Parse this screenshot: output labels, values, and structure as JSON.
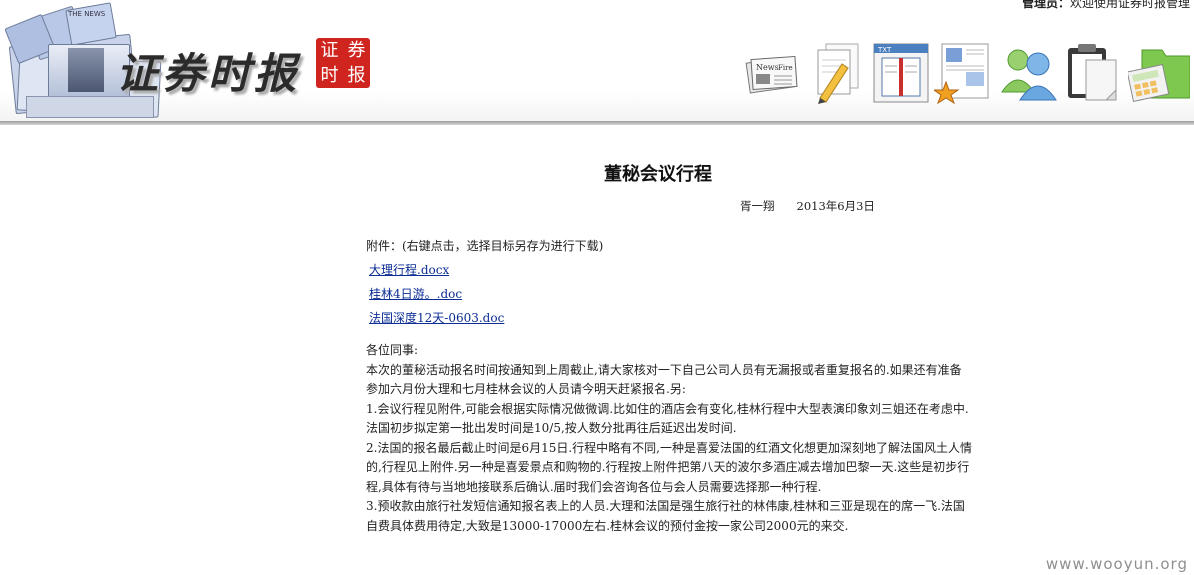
{
  "header": {
    "welcome_role": "管理员：",
    "welcome_text": "欢迎使用证券时报管理",
    "logo_title": "证券时报",
    "seal_chars": [
      "证",
      "券",
      "时",
      "报"
    ],
    "toolbar_icons": [
      {
        "name": "news-icon"
      },
      {
        "name": "edit-document-icon"
      },
      {
        "name": "text-book-icon"
      },
      {
        "name": "favorite-page-icon"
      },
      {
        "name": "users-icon"
      },
      {
        "name": "clipboard-icon"
      },
      {
        "name": "calculator-folder-icon"
      }
    ]
  },
  "article": {
    "title": "董秘会议行程",
    "author": "胥一翔",
    "date": "2013年6月3日",
    "attachment_label": "附件：(右键点击，选择目标另存为进行下载)",
    "attachments": [
      "大理行程.docx",
      "桂林4日游。.doc",
      "法国深度12天-0603.doc"
    ],
    "lines": [
      "各位同事:",
      "本次的董秘活动报名时间按通知到上周截止,请大家核对一下自己公司人员有无漏报或者重复报名的.如果还有准备",
      "参加六月份大理和七月桂林会议的人员请今明天赶紧报名.另:",
      "1.会议行程见附件,可能会根据实际情况做微调.比如住的酒店会有变化,桂林行程中大型表演印象刘三姐还在考虑中.",
      "法国初步拟定第一批出发时间是10/5,按人数分批再往后延迟出发时间.",
      "2.法国的报名最后截止时间是6月15日.行程中略有不同,一种是喜爱法国的红酒文化想更加深刻地了解法国风土人情",
      "的,行程见上附件.另一种是喜爱景点和购物的.行程按上附件把第八天的波尔多酒庄减去增加巴黎一天.这些是初步行",
      "程,具体有待与当地地接联系后确认.届时我们会咨询各位与会人员需要选择那一种行程.",
      "3.预收款由旅行社发短信通知报名表上的人员.大理和法国是强生旅行社的林伟康,桂林和三亚是现在的席一飞.法国",
      "自费具体费用待定,大致是13000-17000左右.桂林会议的预付金按一家公司2000元的来交."
    ]
  },
  "watermark": "www.wooyun.org"
}
